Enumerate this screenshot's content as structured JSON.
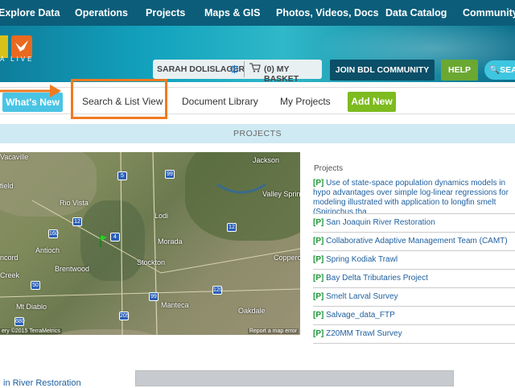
{
  "topnav": {
    "items": [
      "Explore Data",
      "Operations",
      "Projects",
      "Maps & GIS",
      "Photos, Videos, Docs",
      "Data Catalog",
      "Community"
    ]
  },
  "brand": {
    "logo_text": "A LIVE"
  },
  "header": {
    "user_name": "SARAH DOLISLAGER",
    "basket_label": "(0) MY BASKET",
    "join_label": "JOIN BDL COMMUNITY",
    "help_label": "HELP",
    "search_label": "SEA"
  },
  "subnav": {
    "whats_new": "What's New",
    "search_list": "Search & List View",
    "document_library": "Document Library",
    "my_projects": "My Projects",
    "add_new": "Add New"
  },
  "section": {
    "title": "PROJECTS"
  },
  "map": {
    "places": [
      "Vacaville",
      "Jackson",
      "field",
      "Rio Vista",
      "Lodi",
      "Antioch",
      "Brentwood",
      "Morada",
      "Stockton",
      "Copperop",
      "ncord",
      "Creek",
      "Mt Diablo",
      "Manteca",
      "Oakdale",
      "Valley Springs"
    ],
    "shields": [
      "5",
      "99",
      "12",
      "160",
      "4",
      "99",
      "205",
      "680",
      "120",
      "12",
      "50"
    ],
    "attribution": "ery ©2015 TerraMetrics",
    "report": "Report a map error"
  },
  "projects": {
    "heading": "Projects",
    "tag": "[P]",
    "items": [
      "Use of state-space population dynamics models in hypo advantages over simple log-linear regressions for modeling illustrated with application to longfin smelt (Spirinchus tha",
      "San Joaquin River Restoration",
      "Collaborative Adaptive Management Team (CAMT)",
      "Spring Kodiak Trawl",
      "Bay Delta Tributaries Project",
      "Smelt Larval Survey",
      "Salvage_data_FTP",
      "Z20MM Trawl Survey"
    ]
  },
  "bottom": {
    "text": "in River Restoration"
  },
  "colors": {
    "nav": "#0b5d7a",
    "accent_orange": "#f07a21",
    "green": "#7dbb1f",
    "link": "#1e5f9e",
    "tag_green": "#1f9a3a"
  }
}
